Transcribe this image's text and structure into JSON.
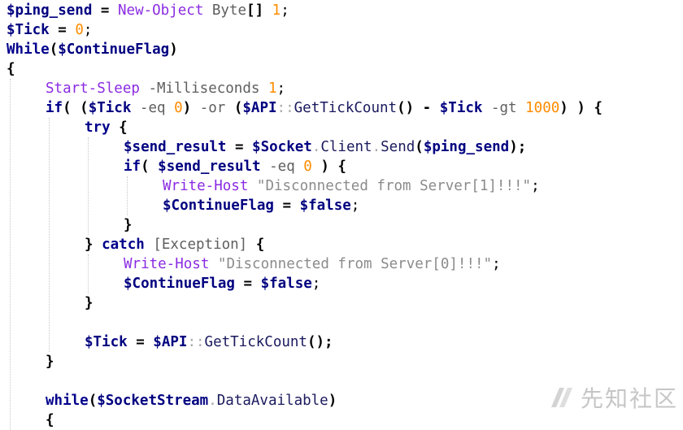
{
  "editor": {
    "lines": [
      {
        "indent": 0,
        "tokens": [
          {
            "t": "$ping_send",
            "c": "v"
          },
          {
            "t": " ",
            "c": "p"
          },
          {
            "t": "=",
            "c": "pb"
          },
          {
            "t": " ",
            "c": "p"
          },
          {
            "t": "New-Object",
            "c": "c"
          },
          {
            "t": " Byte",
            "c": "t"
          },
          {
            "t": "[]",
            "c": "pb"
          },
          {
            "t": " ",
            "c": "p"
          },
          {
            "t": "1",
            "c": "n"
          },
          {
            "t": ";",
            "c": "p"
          }
        ]
      },
      {
        "indent": 0,
        "tokens": [
          {
            "t": "$Tick",
            "c": "v"
          },
          {
            "t": " ",
            "c": "p"
          },
          {
            "t": "=",
            "c": "pb"
          },
          {
            "t": " ",
            "c": "p"
          },
          {
            "t": "0",
            "c": "n"
          },
          {
            "t": ";",
            "c": "p"
          }
        ]
      },
      {
        "indent": 0,
        "tokens": [
          {
            "t": "While",
            "c": "k"
          },
          {
            "t": "(",
            "c": "pb"
          },
          {
            "t": "$ContinueFlag",
            "c": "v"
          },
          {
            "t": ")",
            "c": "pb"
          }
        ]
      },
      {
        "indent": 0,
        "tokens": [
          {
            "t": "{",
            "c": "pb"
          }
        ]
      },
      {
        "indent": 1,
        "tokens": [
          {
            "t": "Start-Sleep",
            "c": "c"
          },
          {
            "t": " ",
            "c": "p"
          },
          {
            "t": "-Milliseconds",
            "c": "t"
          },
          {
            "t": " ",
            "c": "p"
          },
          {
            "t": "1",
            "c": "n"
          },
          {
            "t": ";",
            "c": "p"
          }
        ]
      },
      {
        "indent": 1,
        "tokens": [
          {
            "t": "if",
            "c": "k"
          },
          {
            "t": "( (",
            "c": "pb"
          },
          {
            "t": "$Tick",
            "c": "v"
          },
          {
            "t": " -eq ",
            "c": "t"
          },
          {
            "t": "0",
            "c": "n"
          },
          {
            "t": ")",
            "c": "pb"
          },
          {
            "t": " -or ",
            "c": "t"
          },
          {
            "t": "(",
            "c": "pb"
          },
          {
            "t": "$API",
            "c": "v"
          },
          {
            "t": "::",
            "c": "o"
          },
          {
            "t": "GetTickCount",
            "c": "m"
          },
          {
            "t": "()",
            "c": "pb"
          },
          {
            "t": " - ",
            "c": "pb"
          },
          {
            "t": "$Tick",
            "c": "v"
          },
          {
            "t": " -gt ",
            "c": "t"
          },
          {
            "t": "1000",
            "c": "n"
          },
          {
            "t": ") ) {",
            "c": "pb"
          }
        ]
      },
      {
        "indent": 2,
        "tokens": [
          {
            "t": "try",
            "c": "k"
          },
          {
            "t": " {",
            "c": "pb"
          }
        ]
      },
      {
        "indent": 3,
        "tokens": [
          {
            "t": "$send_result",
            "c": "v"
          },
          {
            "t": " = ",
            "c": "pb"
          },
          {
            "t": "$Socket",
            "c": "v"
          },
          {
            "t": ".",
            "c": "o"
          },
          {
            "t": "Client",
            "c": "m"
          },
          {
            "t": ".",
            "c": "o"
          },
          {
            "t": "Send",
            "c": "m"
          },
          {
            "t": "(",
            "c": "pb"
          },
          {
            "t": "$ping_send",
            "c": "v"
          },
          {
            "t": ");",
            "c": "pb"
          }
        ]
      },
      {
        "indent": 3,
        "tokens": [
          {
            "t": "if",
            "c": "k"
          },
          {
            "t": "( ",
            "c": "pb"
          },
          {
            "t": "$send_result",
            "c": "v"
          },
          {
            "t": " -eq ",
            "c": "t"
          },
          {
            "t": "0",
            "c": "n"
          },
          {
            "t": " ) {",
            "c": "pb"
          }
        ]
      },
      {
        "indent": 4,
        "tokens": [
          {
            "t": "Write-Host",
            "c": "c"
          },
          {
            "t": " ",
            "c": "p"
          },
          {
            "t": "\"Disconnected from Server[1]!!!\"",
            "c": "s"
          },
          {
            "t": ";",
            "c": "p"
          }
        ]
      },
      {
        "indent": 4,
        "tokens": [
          {
            "t": "$ContinueFlag",
            "c": "v"
          },
          {
            "t": " = ",
            "c": "pb"
          },
          {
            "t": "$false",
            "c": "v"
          },
          {
            "t": ";",
            "c": "p"
          }
        ]
      },
      {
        "indent": 3,
        "tokens": [
          {
            "t": "}",
            "c": "pb"
          }
        ]
      },
      {
        "indent": 2,
        "tokens": [
          {
            "t": "}",
            "c": "pb"
          },
          {
            "t": " ",
            "c": "p"
          },
          {
            "t": "catch",
            "c": "k"
          },
          {
            "t": " ",
            "c": "p"
          },
          {
            "t": "[Exception]",
            "c": "t"
          },
          {
            "t": " {",
            "c": "pb"
          }
        ]
      },
      {
        "indent": 3,
        "tokens": [
          {
            "t": "Write-Host",
            "c": "c"
          },
          {
            "t": " ",
            "c": "p"
          },
          {
            "t": "\"Disconnected from Server[0]!!!\"",
            "c": "s"
          },
          {
            "t": ";",
            "c": "p"
          }
        ]
      },
      {
        "indent": 3,
        "tokens": [
          {
            "t": "$ContinueFlag",
            "c": "v"
          },
          {
            "t": " = ",
            "c": "pb"
          },
          {
            "t": "$false",
            "c": "v"
          },
          {
            "t": ";",
            "c": "p"
          }
        ]
      },
      {
        "indent": 2,
        "tokens": [
          {
            "t": "}",
            "c": "pb"
          }
        ]
      },
      {
        "indent": 0,
        "tokens": []
      },
      {
        "indent": 2,
        "tokens": [
          {
            "t": "$Tick",
            "c": "v"
          },
          {
            "t": " = ",
            "c": "pb"
          },
          {
            "t": "$API",
            "c": "v"
          },
          {
            "t": "::",
            "c": "o"
          },
          {
            "t": "GetTickCount",
            "c": "m"
          },
          {
            "t": "();",
            "c": "pb"
          }
        ]
      },
      {
        "indent": 1,
        "tokens": [
          {
            "t": "}",
            "c": "pb"
          }
        ]
      },
      {
        "indent": 0,
        "tokens": []
      },
      {
        "indent": 1,
        "tokens": [
          {
            "t": "while",
            "c": "k"
          },
          {
            "t": "(",
            "c": "pb"
          },
          {
            "t": "$SocketStream",
            "c": "v"
          },
          {
            "t": ".",
            "c": "o"
          },
          {
            "t": "DataAvailable",
            "c": "m"
          },
          {
            "t": ")",
            "c": "pb"
          }
        ]
      },
      {
        "indent": 1,
        "tokens": [
          {
            "t": "{",
            "c": "pb"
          }
        ]
      }
    ]
  },
  "watermark": {
    "text": "先知社区",
    "icon": "xianzhi-logo-icon"
  }
}
